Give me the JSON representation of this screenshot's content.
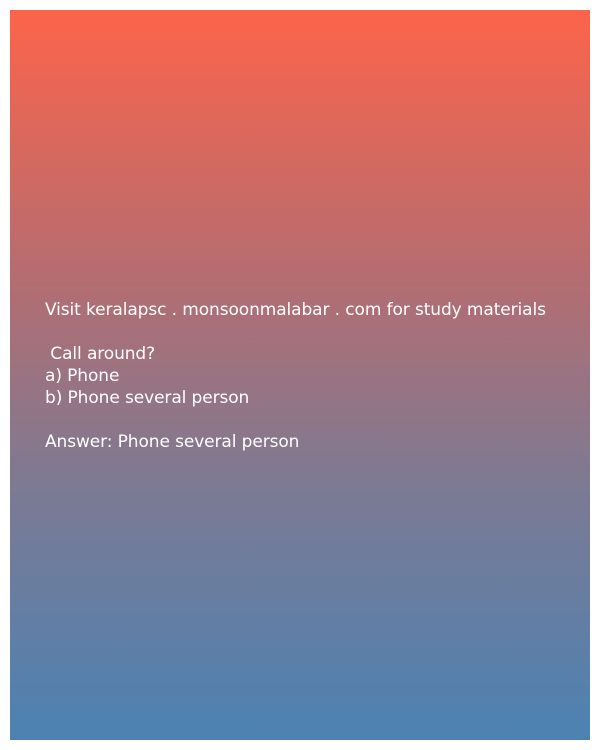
{
  "card": {
    "site_line": "Visit keralapsc . monsoonmalabar . com for study materials",
    "question": " Call around?",
    "options": [
      "a) Phone",
      "b) Phone several person"
    ],
    "answer": "Answer: Phone several person"
  },
  "colors": {
    "gradient_top": "#fd644a",
    "gradient_bottom": "#4c82b2",
    "text": "#ffffff"
  }
}
